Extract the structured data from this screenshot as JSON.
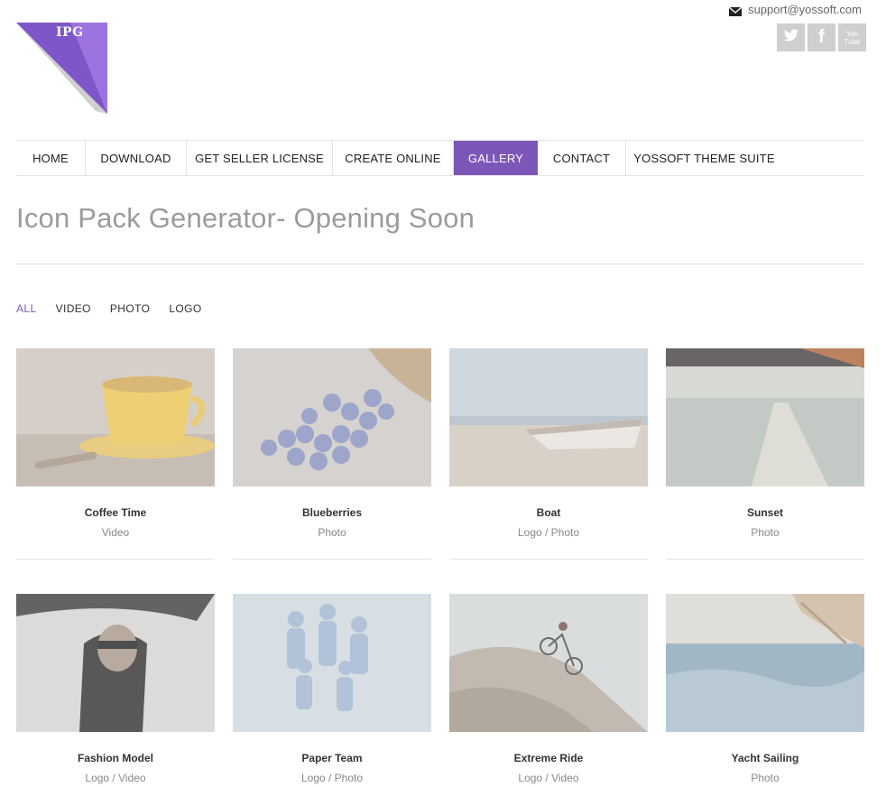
{
  "brand": {
    "logo_text": "IPG"
  },
  "header": {
    "support_email": "support@yossoft.com",
    "social": [
      {
        "name": "twitter",
        "icon": "twitter-icon"
      },
      {
        "name": "facebook",
        "icon": "facebook-icon",
        "glyph": "f"
      },
      {
        "name": "youtube",
        "icon": "youtube-icon",
        "glyph": "You Tube"
      }
    ]
  },
  "nav": {
    "items": [
      {
        "label": "HOME"
      },
      {
        "label": "DOWNLOAD"
      },
      {
        "label": "GET SELLER LICENSE"
      },
      {
        "label": "CREATE ONLINE"
      },
      {
        "label": "GALLERY",
        "active": true
      },
      {
        "label": "CONTACT"
      },
      {
        "label": "YOSSOFT THEME SUITE"
      }
    ]
  },
  "page": {
    "title": "Icon Pack Generator- Opening Soon"
  },
  "filters": {
    "items": [
      {
        "label": "ALL",
        "active": true
      },
      {
        "label": "VIDEO"
      },
      {
        "label": "PHOTO"
      },
      {
        "label": "LOGO"
      }
    ]
  },
  "gallery": {
    "items": [
      {
        "title": "Coffee Time",
        "category": "Video"
      },
      {
        "title": "Blueberries",
        "category": "Photo"
      },
      {
        "title": "Boat",
        "category": "Logo / Photo"
      },
      {
        "title": "Sunset",
        "category": "Photo"
      },
      {
        "title": "Fashion Model",
        "category": "Logo / Video"
      },
      {
        "title": "Paper Team",
        "category": "Logo / Photo"
      },
      {
        "title": "Extreme Ride",
        "category": "Logo / Video"
      },
      {
        "title": "Yacht Sailing",
        "category": "Photo"
      }
    ]
  },
  "colors": {
    "accent": "#7d57b8",
    "text_muted": "#9b9b9b",
    "social_bg": "#cfcfcf"
  }
}
